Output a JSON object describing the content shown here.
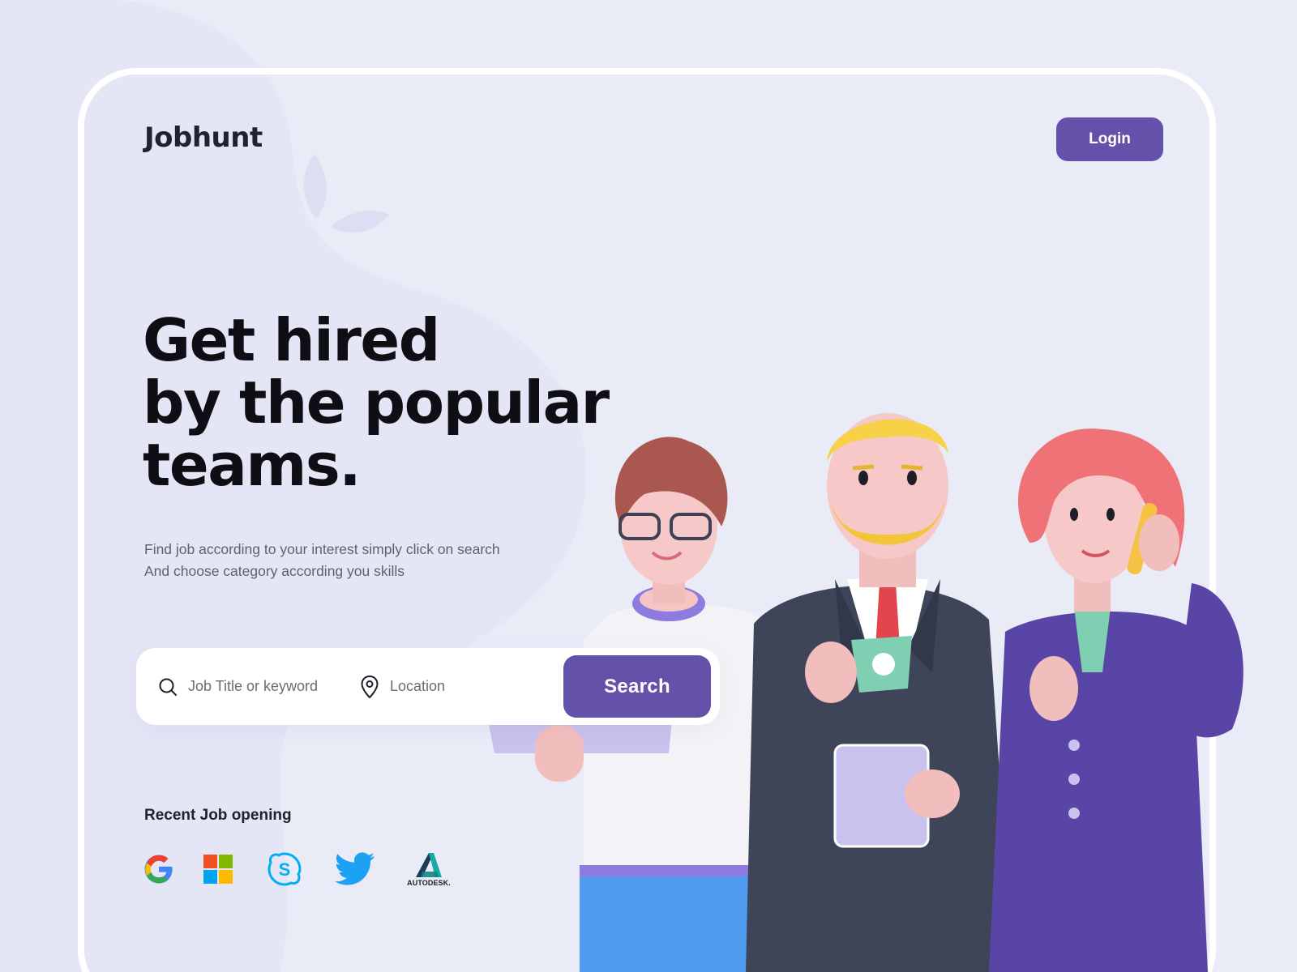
{
  "brand": {
    "name": "Jobhunt",
    "accent_color": "#6351AA",
    "background_color": "#E9EBF7"
  },
  "header": {
    "login_label": "Login"
  },
  "hero": {
    "headline_lines": [
      "Get hired",
      "by the popular",
      "teams."
    ],
    "subtext_lines": [
      "Find job according to your interest simply click on search",
      "And choose category according you skills"
    ]
  },
  "search": {
    "keyword_placeholder": "Job Title or keyword",
    "location_placeholder": "Location",
    "button_label": "Search",
    "keyword_icon": "search-icon",
    "location_icon": "map-pin-icon"
  },
  "recent_jobs": {
    "title": "Recent Job opening",
    "companies": [
      {
        "name": "Google",
        "icon": "google-logo"
      },
      {
        "name": "Microsoft",
        "icon": "microsoft-logo"
      },
      {
        "name": "Skype",
        "icon": "skype-logo"
      },
      {
        "name": "Twitter",
        "icon": "twitter-logo"
      },
      {
        "name": "Autodesk",
        "icon": "autodesk-logo",
        "label": "AUTODESK."
      }
    ]
  }
}
